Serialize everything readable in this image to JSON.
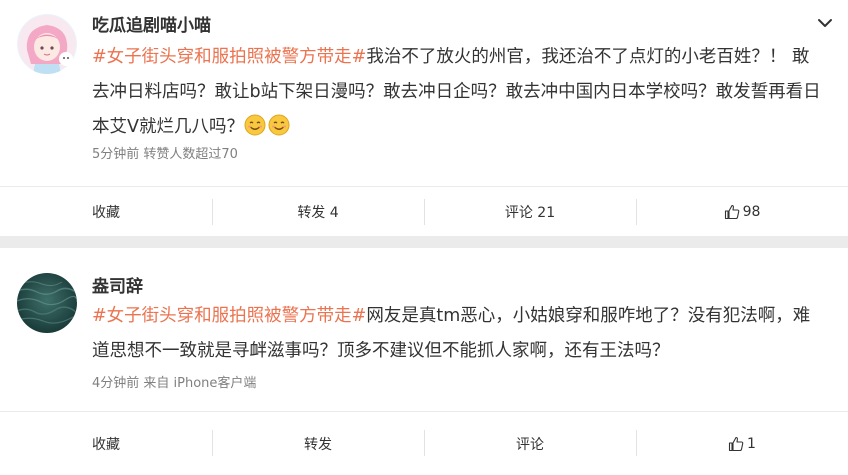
{
  "posts": [
    {
      "username": "吃瓜追剧喵小喵",
      "hashtag": "#女子街头穿和服拍照被警方带走#",
      "body": "我治不了放火的州官，我还治不了点灯的小老百姓？！ 敢去冲日料店吗？敢让b站下架日漫吗？敢去冲日企吗？敢去冲中国内日本学校吗？敢发誓再看日本艾V就烂几八吗？",
      "emojis": [
        "smile-emoji",
        "smile-emoji"
      ],
      "meta": "5分钟前 转赞人数超过70",
      "actions": {
        "favorite": "收藏",
        "repost": "转发 4",
        "comment": "评论 21",
        "like": "98"
      }
    },
    {
      "username": "盎司辞",
      "hashtag": "#女子街头穿和服拍照被警方带走#",
      "body": "网友是真tm恶心，小姑娘穿和服咋地了？没有犯法啊，难道思想不一致就是寻衅滋事吗？顶多不建议但不能抓人家啊，还有王法吗？",
      "meta": "4分钟前 来自 iPhone客户端",
      "actions": {
        "favorite": "收藏",
        "repost": "转发",
        "comment": "评论",
        "like": "1"
      }
    }
  ],
  "colors": {
    "hashtag": "#eb7350",
    "background": "#ebebeb"
  },
  "icons": {
    "menu": "chevron-down-icon",
    "like": "thumbs-up-icon"
  }
}
